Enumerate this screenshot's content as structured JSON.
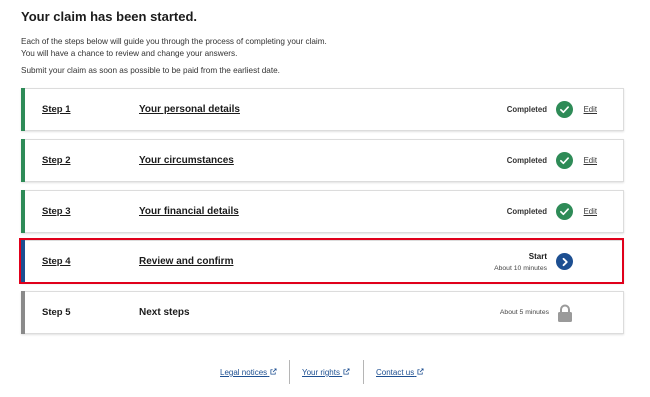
{
  "page": {
    "heading": "Your claim has been started.",
    "intro_line1": "Each of the steps below will guide you through the process of completing your claim.",
    "intro_line2": "You will have a chance to review and change your answers.",
    "intro_line3": "Submit your claim as soon as possible to be paid from the earliest date."
  },
  "steps": [
    {
      "number": "Step 1",
      "title": "Your personal details",
      "status": "Completed",
      "action": "Edit"
    },
    {
      "number": "Step 2",
      "title": "Your circumstances",
      "status": "Completed",
      "action": "Edit"
    },
    {
      "number": "Step 3",
      "title": "Your financial details",
      "status": "Completed",
      "action": "Edit"
    },
    {
      "number": "Step 4",
      "title": "Review and confirm",
      "status": "Start",
      "time": "About 10 minutes"
    },
    {
      "number": "Step 5",
      "title": "Next steps",
      "time": "About 5 minutes"
    }
  ],
  "footer": {
    "legal": "Legal notices",
    "rights": "Your rights",
    "contact": "Contact us"
  },
  "colors": {
    "completed": "#2e8b57",
    "active": "#1d4f91",
    "locked": "#8a8a8a",
    "highlight": "#e0001b"
  }
}
